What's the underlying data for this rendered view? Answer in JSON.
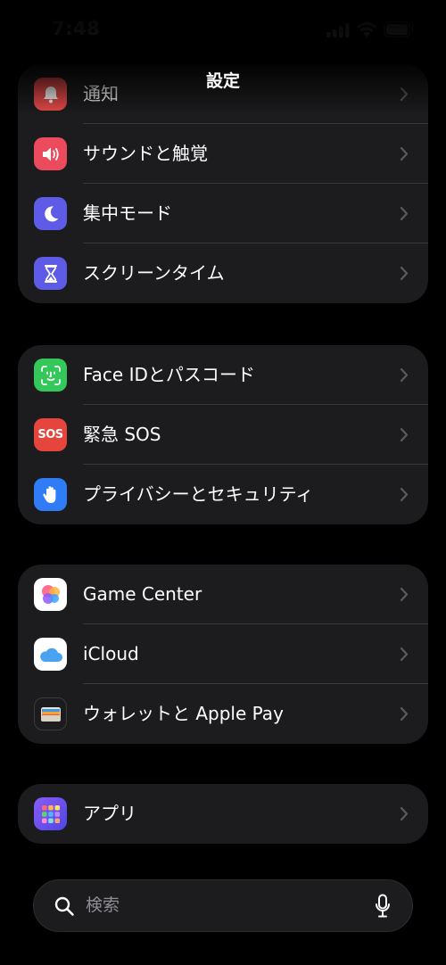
{
  "status_bar": {
    "time": "7:48"
  },
  "nav": {
    "title": "設定"
  },
  "groups": [
    {
      "rows": [
        {
          "label": "通知",
          "icon": "bell-icon",
          "color": "#eb4b4b"
        },
        {
          "label": "サウンドと触覚",
          "icon": "speaker-icon",
          "color": "#eb4b5c"
        },
        {
          "label": "集中モード",
          "icon": "moon-icon",
          "color": "#5e5ce6"
        },
        {
          "label": "スクリーンタイム",
          "icon": "hourglass-icon",
          "color": "#5e5ce6"
        }
      ]
    },
    {
      "rows": [
        {
          "label": "Face IDとパスコード",
          "icon": "face-id-icon",
          "color": "#34c759"
        },
        {
          "label": "緊急 SOS",
          "icon": "sos-icon",
          "color": "#e5453d",
          "icon_text": "SOS"
        },
        {
          "label": "プライバシーとセキュリティ",
          "icon": "hand-icon",
          "color": "#2f7cf6"
        }
      ]
    },
    {
      "rows": [
        {
          "label": "Game Center",
          "icon": "game-center-icon",
          "color": "#ffffff"
        },
        {
          "label": "iCloud",
          "icon": "icloud-icon",
          "color": "#ffffff"
        },
        {
          "label": "ウォレットと Apple Pay",
          "icon": "wallet-icon",
          "color": "#1c1c1e"
        }
      ]
    },
    {
      "rows": [
        {
          "label": "アプリ",
          "icon": "apps-grid-icon",
          "color": "#6a4cf0"
        }
      ]
    }
  ],
  "search": {
    "placeholder": "検索"
  }
}
